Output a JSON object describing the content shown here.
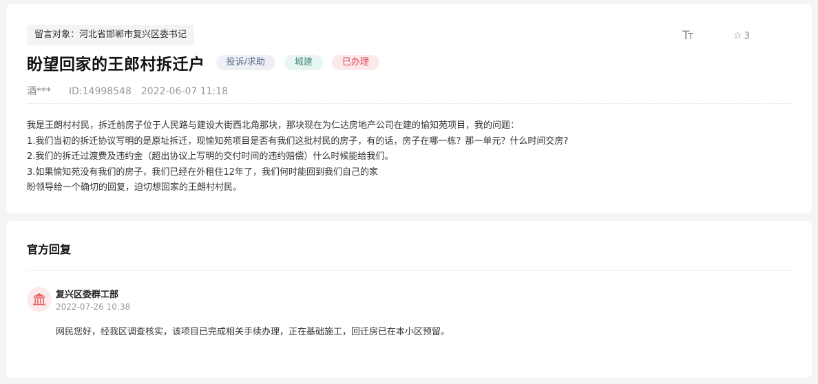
{
  "message": {
    "target_label": "留言对象：",
    "target_value": "河北省邯郸市复兴区委书记",
    "title": "盼望回家的王郎村拆迁户",
    "tags": {
      "type": "投诉/求助",
      "category": "城建",
      "status": "已办理"
    },
    "author": "酒***",
    "id_text": "ID:14998548",
    "datetime": "2022-06-07 11:18",
    "font_size_icon": "text-size-icon",
    "star_count": "3",
    "content_lines": [
      "我是王朗村村民，拆迁前房子位于人民路与建设大街西北角那块，那块现在为仁达房地产公司在建的愉知苑项目，我的问题：",
      "1.我们当初的拆迁协议写明的是原址拆迁，现愉知苑项目是否有我们这批村民的房子，有的话，房子在哪一栋？那一单元？什么时间交房?",
      "2.我们的拆迁过渡费及违约金（超出协议上写明的交付时间的违约赔偿）什么时候能给我们。",
      "3.如果愉知苑没有我们的房子，我们已经在外租住12年了，我们何时能回到我们自己的家",
      "盼领导给一个确切的回复，迫切想回家的王朗村村民。"
    ]
  },
  "reply": {
    "section_title": "官方回复",
    "department": "复兴区委群工部",
    "datetime": "2022-07-26 10:38",
    "text": "网民您好，经我区调查核实，该项目已完成相关手续办理，正在基础施工，回迁房已在本小区预留。",
    "avatar_icon": "government-building-icon"
  },
  "colors": {
    "status_red": "#d4434f",
    "avatar_red": "#e46a6a"
  }
}
